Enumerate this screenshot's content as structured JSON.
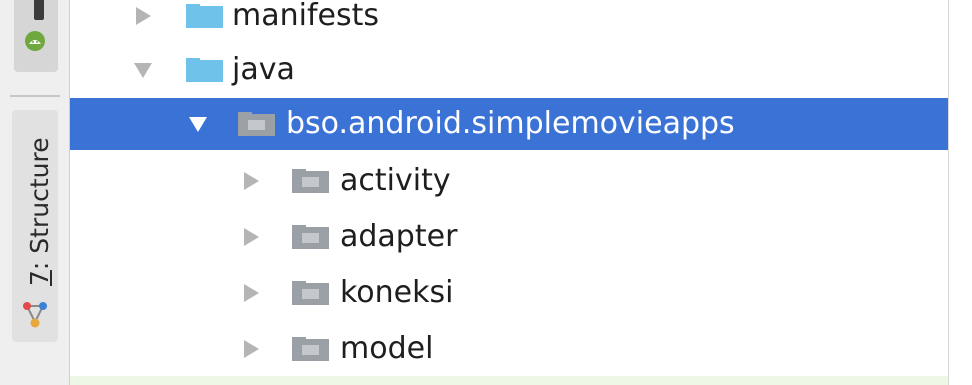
{
  "tool_strip": {
    "top_tab_icon": "android-icon",
    "structure_tab": {
      "number": "7",
      "label": ": Structure",
      "icon": "structure-icon"
    }
  },
  "tree": {
    "rows": [
      {
        "label": "manifests",
        "expanded": false,
        "selected": false,
        "icon": "folder-icon-blue"
      },
      {
        "label": "java",
        "expanded": true,
        "selected": false,
        "icon": "folder-icon-blue"
      },
      {
        "label": "bso.android.simplemovieapps",
        "expanded": true,
        "selected": true,
        "icon": "package-folder-icon"
      },
      {
        "label": "activity",
        "expanded": false,
        "selected": false,
        "icon": "package-folder-icon"
      },
      {
        "label": "adapter",
        "expanded": false,
        "selected": false,
        "icon": "package-folder-icon"
      },
      {
        "label": "koneksi",
        "expanded": false,
        "selected": false,
        "icon": "package-folder-icon"
      },
      {
        "label": "model",
        "expanded": false,
        "selected": false,
        "icon": "package-folder-icon"
      }
    ]
  },
  "colors": {
    "selection": "#3a72d6",
    "folder_blue": "#6fc3ea",
    "package_gray": "#9aa0a6",
    "arrow_gray": "#b5b5b5"
  }
}
